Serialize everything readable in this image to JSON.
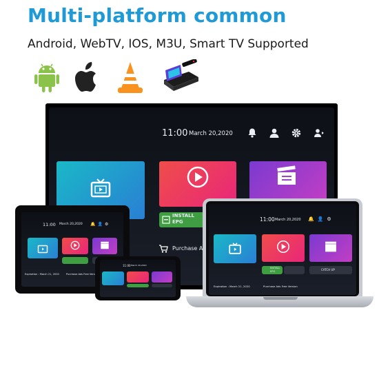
{
  "header": {
    "title": "Multi-platform common",
    "subtitle": "Android, WebTV, IOS, M3U, Smart TV Supported"
  },
  "platform_icons": [
    "android-icon",
    "apple-icon",
    "vlc-icon",
    "tv-box-icon"
  ],
  "tv": {
    "time": "11:00",
    "date": "March 20,2020",
    "install_label": "INSTALL",
    "install_sub": "EPG",
    "purchase_label": "Purchase Ad"
  },
  "tablet": {
    "time": "11:00",
    "date": "March 20,2020",
    "expiration": "Expiration : March 21, 2020",
    "purchase": "Purchase Ads Free Version"
  },
  "laptop": {
    "time": "11:00",
    "date": "March 20,2020",
    "install": "INSTALL EPG",
    "catchup": "CATCH UP",
    "expiration": "Expiration : March 21, 2020",
    "purchase": "Purchase Ads Free Version"
  },
  "phone": {
    "time": "11:00",
    "date": "March 20,2020"
  },
  "colors": {
    "headline": "#1f9ad6",
    "tile_live": "#14a4c8",
    "tile_vod": "#ea3f46",
    "tile_series": "#8a36c9",
    "tile_green": "#3c9b3c"
  }
}
